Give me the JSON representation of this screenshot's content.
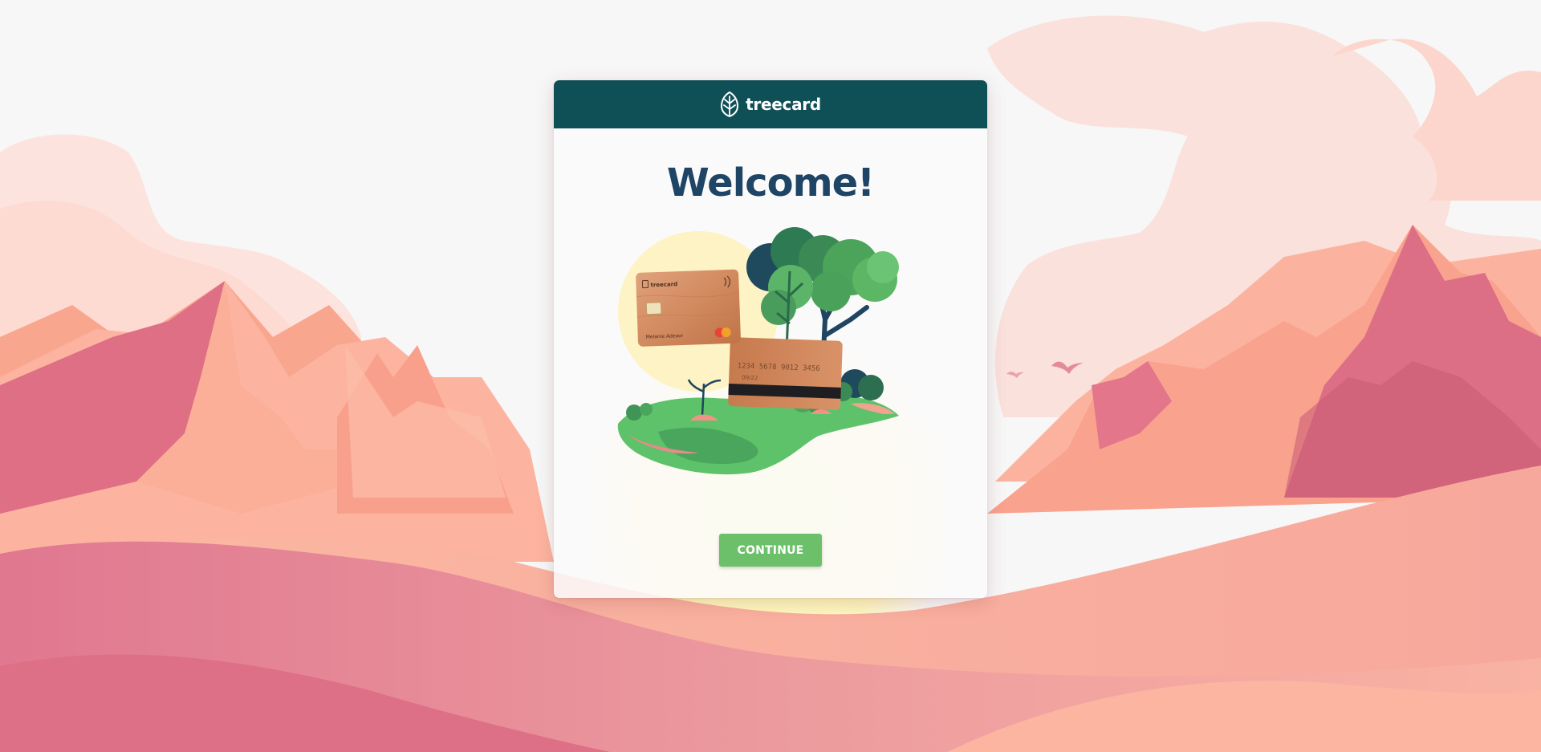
{
  "brand": {
    "name": "treecard",
    "header_color": "#0f4f56",
    "icon": "leaf-logo-icon"
  },
  "welcome": {
    "title": "Welcome!"
  },
  "illustration": {
    "front_card": {
      "brand": "treecard",
      "holder": "Melanie Adeaor",
      "network_icon": "mastercard-icon",
      "chip_icon": "chip-icon",
      "contactless_icon": "contactless-icon"
    },
    "back_card": {
      "number": "1234  5678  9012  3456",
      "expiry": "09/22"
    }
  },
  "actions": {
    "continue_label": "CONTINUE",
    "continue_color": "#6cc06a"
  },
  "background": {
    "sky": "#f7f7f7",
    "mountain_dark": "#dc6f86",
    "mountain_light": "#fbb4a0",
    "sun": "#fff7a4"
  }
}
